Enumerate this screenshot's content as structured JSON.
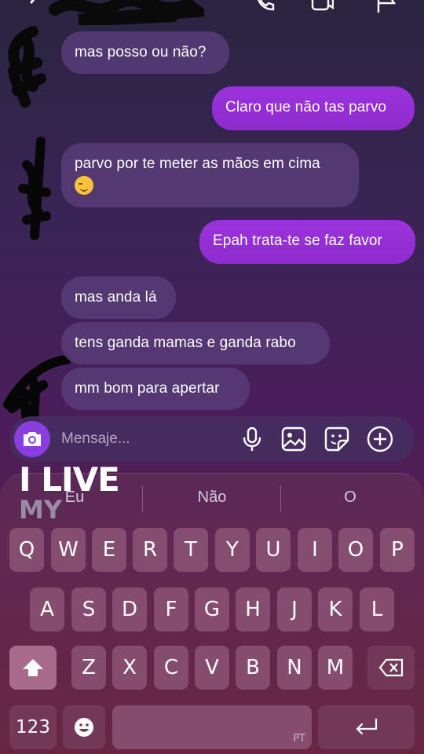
{
  "messages": [
    {
      "from": "them",
      "text": "mas posso ou não?"
    },
    {
      "from": "me",
      "text": "Claro que não tas parvo"
    },
    {
      "from": "them",
      "text": "parvo por te meter as mãos em cima",
      "emoji": "smirk-emoji"
    },
    {
      "from": "me",
      "text": "Epah trata-te se faz favor"
    },
    {
      "from": "them",
      "text": "mas anda lá"
    },
    {
      "from": "them",
      "text": "tens ganda mamas e ganda rabo"
    },
    {
      "from": "them",
      "text": "mm bom para apertar"
    }
  ],
  "composer": {
    "placeholder": "Mensaje...",
    "icons": [
      "camera-icon",
      "microphone-icon",
      "gallery-icon",
      "sticker-icon",
      "add-icon"
    ]
  },
  "watermark": {
    "line1": "I LIVE",
    "line2": "MY"
  },
  "keyboard": {
    "suggestions": [
      "Eu",
      "Não",
      "O"
    ],
    "row1": [
      "Q",
      "W",
      "E",
      "R",
      "T",
      "Y",
      "U",
      "I",
      "O",
      "P"
    ],
    "row2": [
      "A",
      "S",
      "D",
      "F",
      "G",
      "H",
      "J",
      "K",
      "L"
    ],
    "row3": [
      "Z",
      "X",
      "C",
      "V",
      "B",
      "N",
      "M"
    ],
    "numbers_label": "123",
    "language_label": "PT",
    "icons": [
      "shift-icon",
      "backspace-icon",
      "emoji-icon",
      "return-icon"
    ]
  },
  "colors": {
    "sent_bubble": "#9b33dc",
    "received_bubble": "#583c78",
    "accent": "#8a3ee0"
  }
}
